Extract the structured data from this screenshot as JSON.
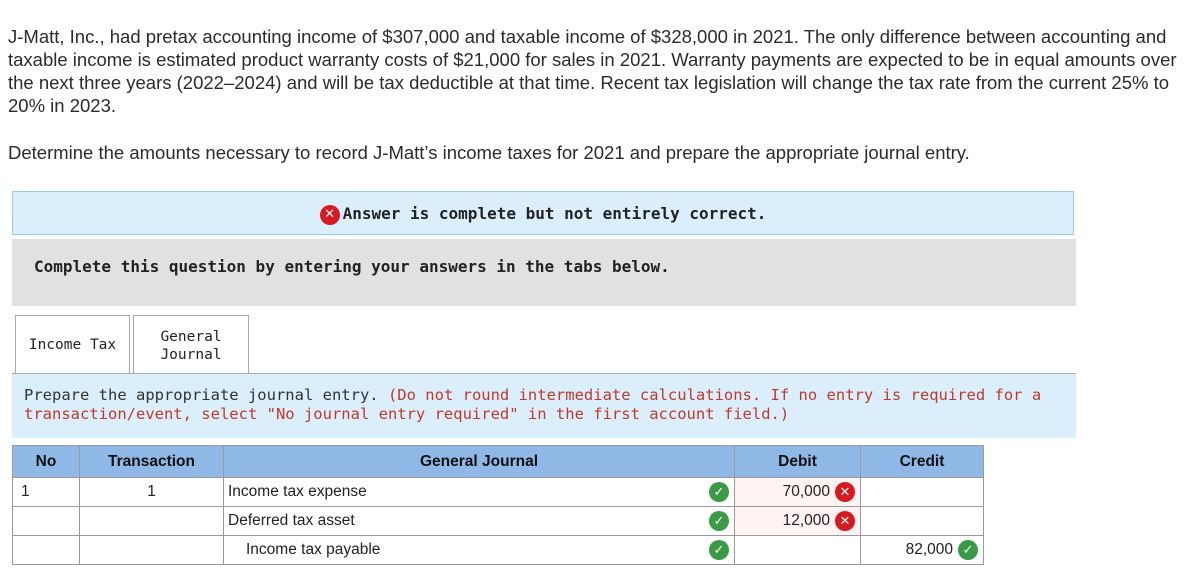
{
  "question": {
    "paragraph": "J-Matt, Inc., had pretax accounting income of $307,000 and taxable income of $328,000 in 2021. The only difference between accounting and taxable income is estimated product warranty costs of $21,000 for sales in 2021. Warranty payments are expected to be in equal amounts over the next three years (2022–2024) and will be tax deductible at that time. Recent tax legislation will change the tax rate from the current 25% to 20% in 2023.",
    "prompt": "Determine the amounts necessary to record J-Matt’s income taxes for 2021 and prepare the appropriate journal entry."
  },
  "feedback": {
    "message": "Answer is complete but not entirely correct.",
    "icon": "x-circle-icon",
    "color": "#d71920"
  },
  "instructions_box": {
    "text": "Complete this question by entering your answers in the tabs below."
  },
  "tabs": [
    {
      "label": "Income Tax",
      "active": false
    },
    {
      "label_line1": "General",
      "label_line2": "Journal",
      "active": true
    }
  ],
  "journal_instruction": {
    "main": "Prepare the appropriate journal entry.",
    "note": "(Do not round intermediate calculations. If no entry is required for a transaction/event, select \"No journal entry required\" in the first account field.)"
  },
  "table": {
    "headers": {
      "no": "No",
      "transaction": "Transaction",
      "account": "General Journal",
      "debit": "Debit",
      "credit": "Credit"
    },
    "rows": [
      {
        "no": "1",
        "transaction": "1",
        "account": "Income tax expense",
        "account_status": "correct",
        "debit": "70,000",
        "debit_status": "incorrect",
        "credit": "",
        "credit_status": ""
      },
      {
        "no": "",
        "transaction": "",
        "account": "Deferred tax asset",
        "account_status": "correct",
        "debit": "12,000",
        "debit_status": "incorrect",
        "credit": "",
        "credit_status": ""
      },
      {
        "no": "",
        "transaction": "",
        "account": "Income tax payable",
        "account_status": "correct",
        "debit": "",
        "debit_status": "",
        "credit": "82,000",
        "credit_status": "correct"
      }
    ]
  },
  "colors": {
    "header_bg": "#8fb8e6",
    "banner_bg": "#dbeefb",
    "correct": "#3a9a46",
    "incorrect": "#d71920"
  }
}
